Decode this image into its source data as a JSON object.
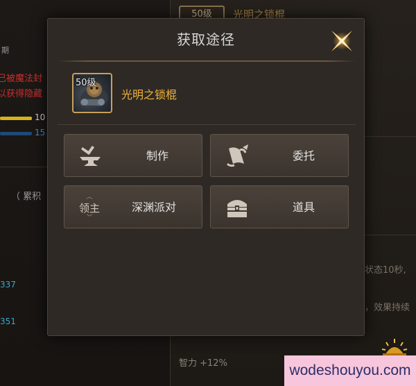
{
  "background": {
    "left_texts": [
      {
        "text": "期",
        "color": "#9a9a9a"
      },
      {
        "text": "已被魔法封",
        "color": "#c83030"
      },
      {
        "text": "以获得隐藏",
        "color": "#c83030"
      },
      {
        "text": "10",
        "color": "#cfcfcf"
      },
      {
        "text": "15",
        "color": "#3b8fd8"
      },
      {
        "text": "（ 累积",
        "color": "#9a9a9a"
      },
      {
        "text": "337",
        "color": "#3aa8c8"
      },
      {
        "text": "351",
        "color": "#3aa8c8"
      }
    ],
    "right_header_level": "50级",
    "right_header_name": "光明之锁棍",
    "right_texts": [
      {
        "text": "状态10秒,",
        "color": "#7a7268"
      },
      {
        "text": "，效果持续",
        "color": "#7a7268"
      },
      {
        "text": "智力 +12%",
        "color": "#8a8278"
      }
    ],
    "watermark": "wodeshouyou.com"
  },
  "modal": {
    "title": "获取途径",
    "item": {
      "level": "50级",
      "name": "光明之锁棍"
    },
    "sources": [
      {
        "label": "制作",
        "icon": "anvil-icon"
      },
      {
        "label": "委托",
        "icon": "scroll-icon"
      },
      {
        "label": "深渊派对",
        "icon_text": "领主",
        "icon": "lord-icon"
      },
      {
        "label": "道具",
        "icon": "chest-icon"
      }
    ]
  }
}
